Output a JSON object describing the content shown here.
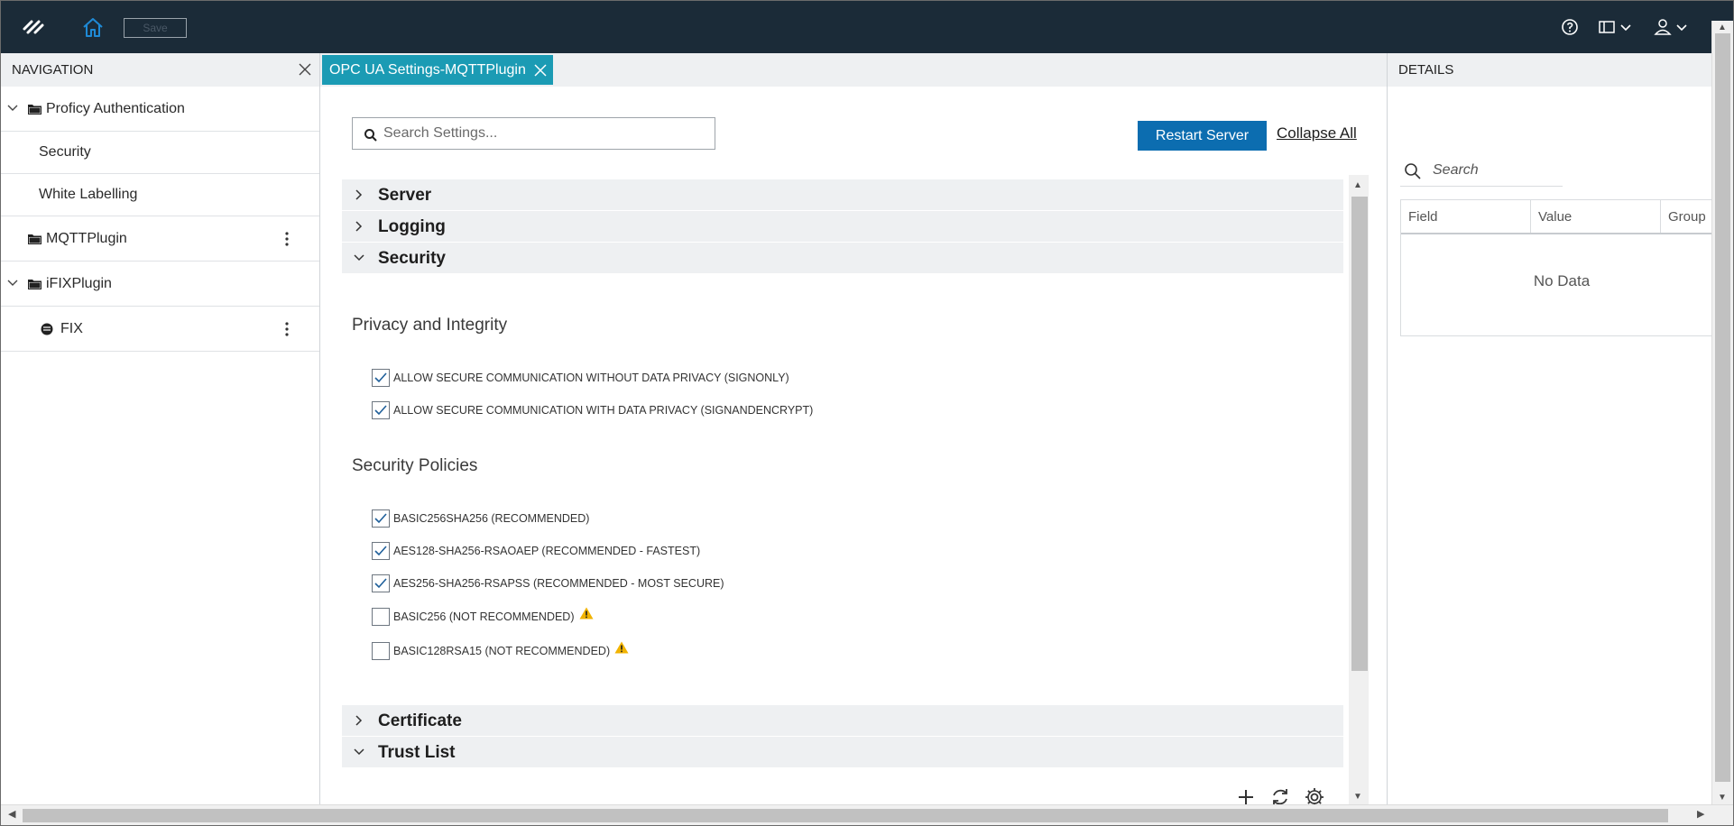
{
  "topbar": {
    "save_label": "Save"
  },
  "navigation": {
    "title": "NAVIGATION",
    "items": [
      {
        "label": "Proficy Authentication"
      },
      {
        "label": "Security"
      },
      {
        "label": "White Labelling"
      },
      {
        "label": "MQTTPlugin"
      },
      {
        "label": "iFIXPlugin"
      },
      {
        "label": "FIX"
      }
    ]
  },
  "tab": {
    "label": "OPC UA Settings-MQTTPlugin"
  },
  "main": {
    "search_placeholder": "Search Settings...",
    "restart_label": "Restart Server",
    "collapse_label": "Collapse All",
    "sections": [
      {
        "label": "Server",
        "expanded": false
      },
      {
        "label": "Logging",
        "expanded": false
      },
      {
        "label": "Security",
        "expanded": true
      },
      {
        "label": "Certificate",
        "expanded": false
      },
      {
        "label": "Trust List",
        "expanded": true
      }
    ],
    "privacy_heading": "Privacy and Integrity",
    "privacy_options": [
      {
        "label": "ALLOW SECURE COMMUNICATION WITHOUT DATA PRIVACY (SIGNONLY)",
        "checked": true
      },
      {
        "label": "ALLOW SECURE COMMUNICATION WITH DATA PRIVACY (SIGNANDENCRYPT)",
        "checked": true
      }
    ],
    "policies_heading": "Security Policies",
    "policies": [
      {
        "label": "BASIC256SHA256 (RECOMMENDED)",
        "checked": true,
        "warning": false
      },
      {
        "label": "AES128-SHA256-RSAOAEP (RECOMMENDED - FASTEST)",
        "checked": true,
        "warning": false
      },
      {
        "label": "AES256-SHA256-RSAPSS (RECOMMENDED - MOST SECURE)",
        "checked": true,
        "warning": false
      },
      {
        "label": "BASIC256 (NOT RECOMMENDED)",
        "checked": false,
        "warning": true
      },
      {
        "label": "BASIC128RSA15 (NOT RECOMMENDED)",
        "checked": false,
        "warning": true
      }
    ]
  },
  "details": {
    "title": "DETAILS",
    "search_placeholder": "Search",
    "columns": [
      "Field",
      "Value",
      "Group"
    ],
    "empty_text": "No Data"
  },
  "colors": {
    "topbar": "#1b2b38",
    "tab_active": "#1b9bb4",
    "primary_button": "#0c6db0",
    "warning": "#f1b300",
    "home_icon": "#1f8ad6"
  }
}
